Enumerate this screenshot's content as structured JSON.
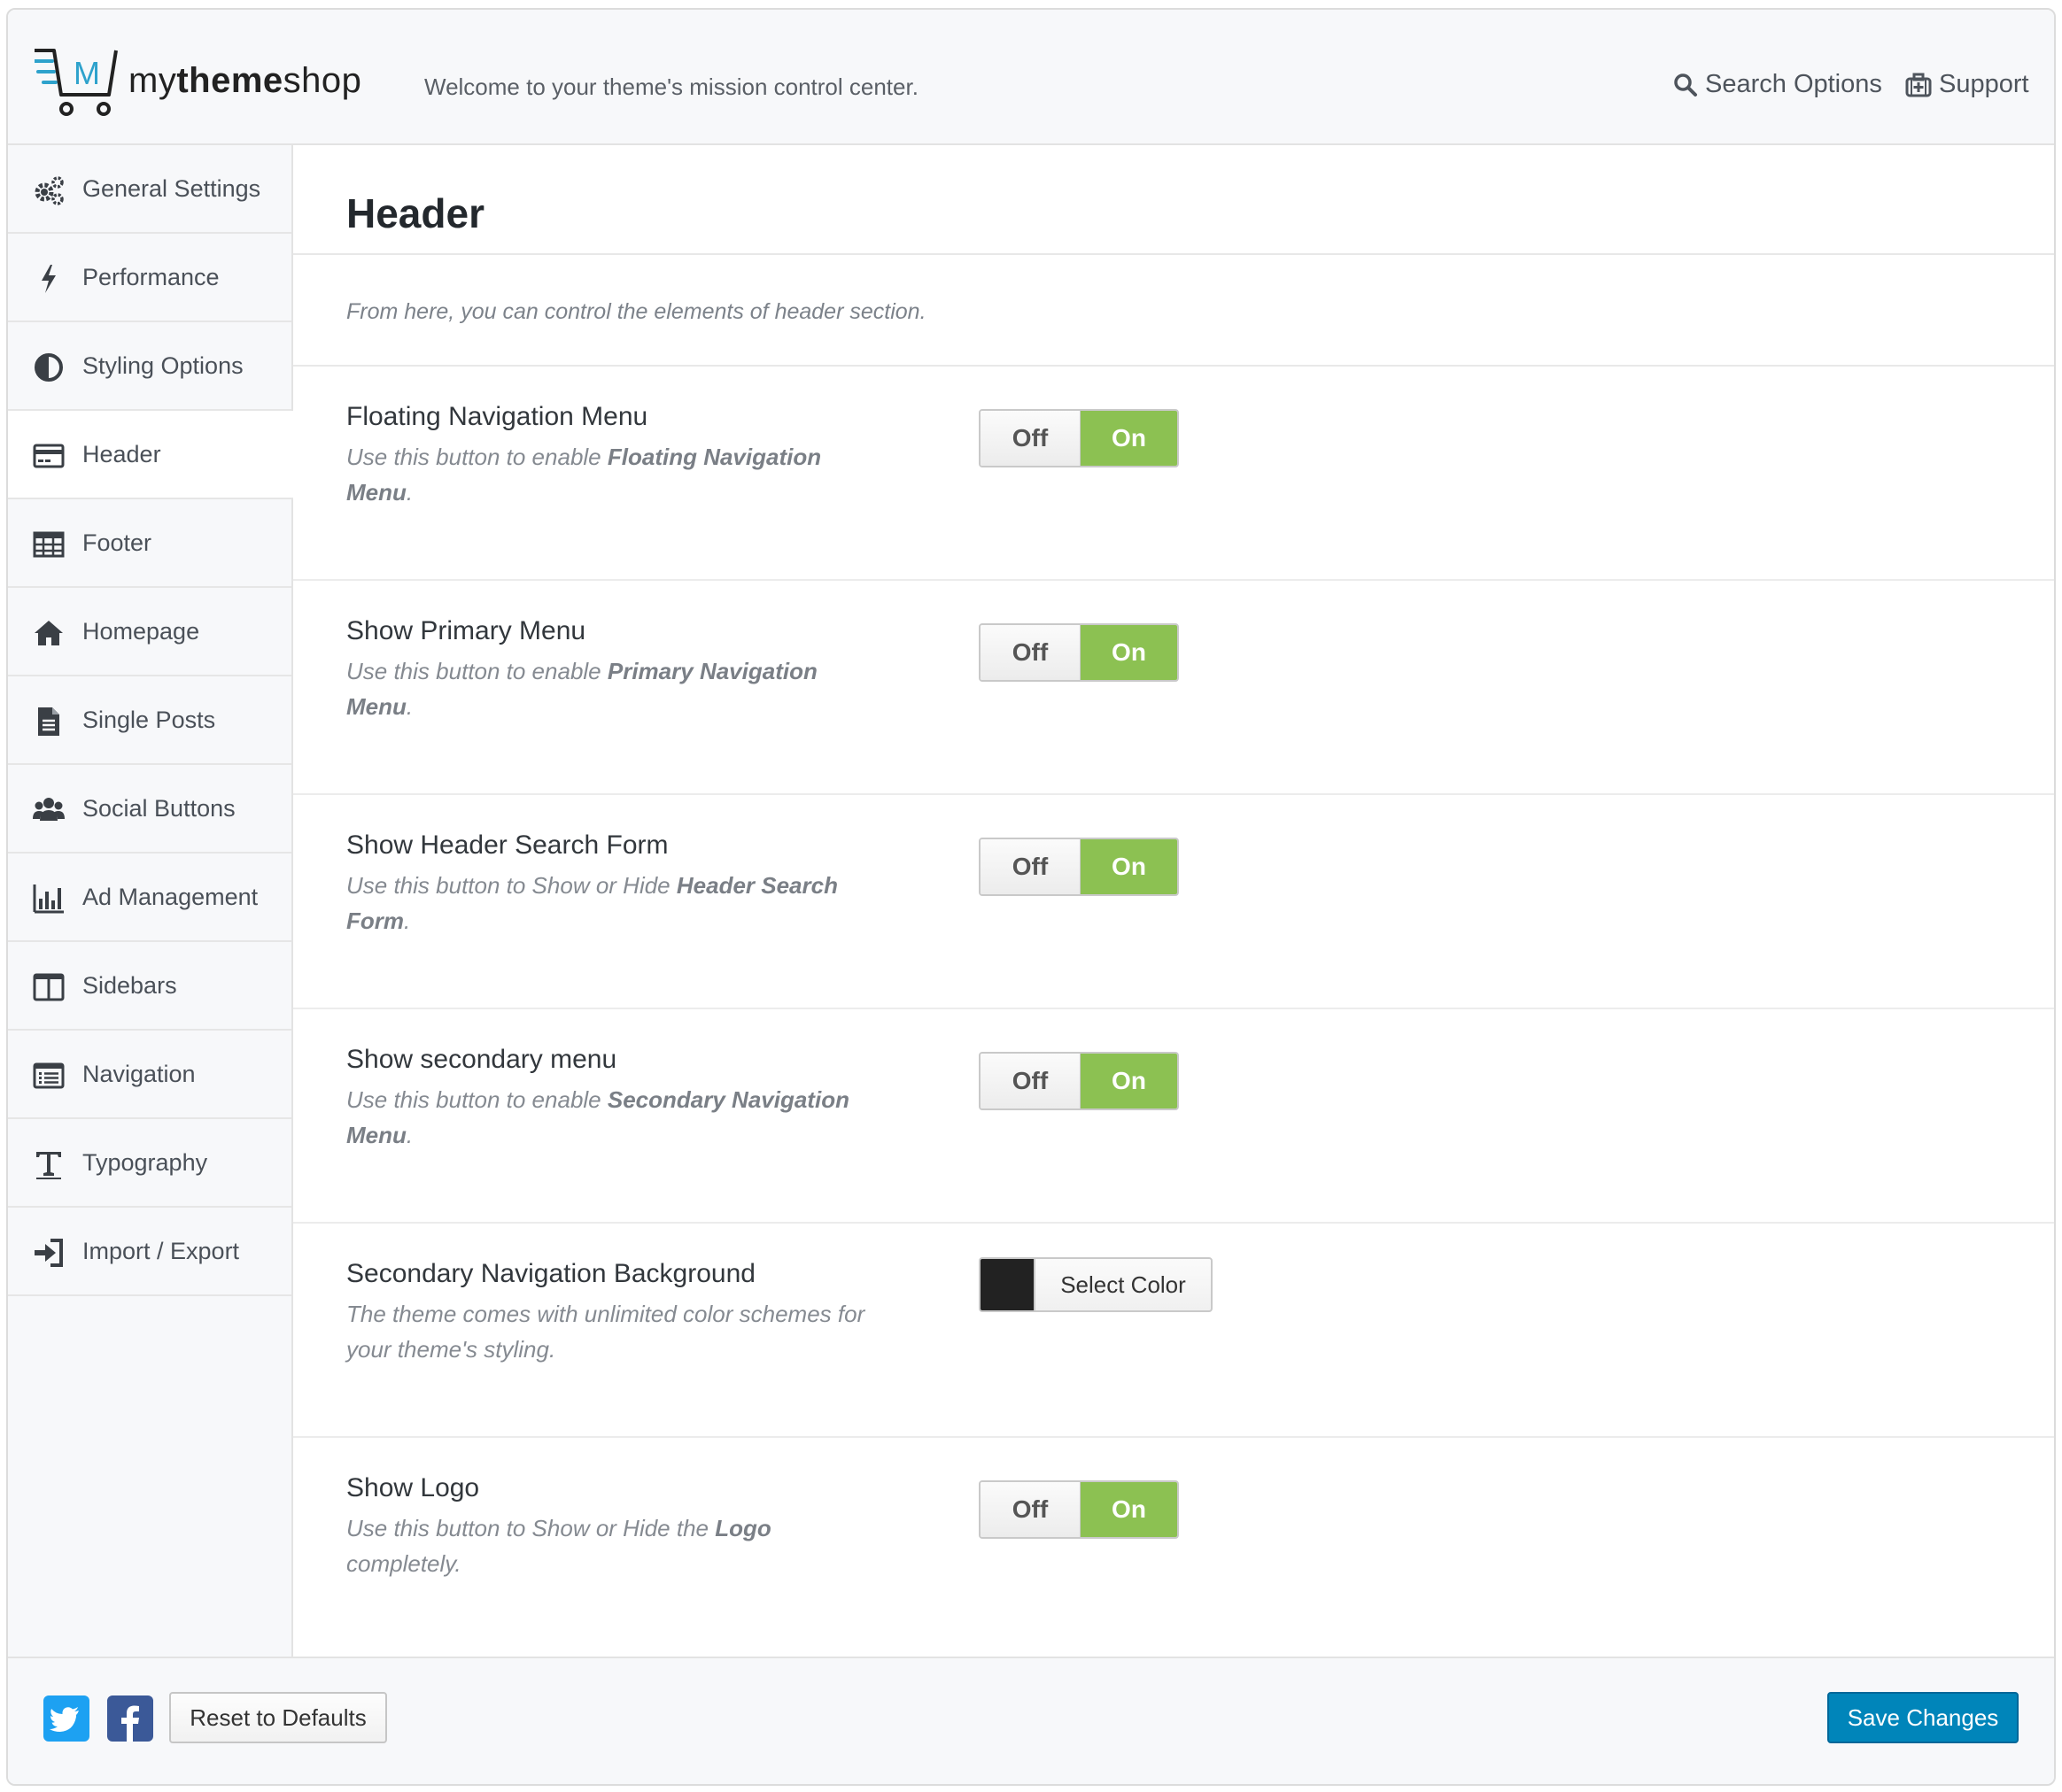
{
  "brand": {
    "name_prefix": "my",
    "name_bold": "theme",
    "name_suffix": "shop",
    "logo_letter": "M",
    "accent": "#2ea2cc"
  },
  "header": {
    "tagline": "Welcome to your theme's mission control center.",
    "search_label": "Search Options",
    "support_label": "Support"
  },
  "sidebar": {
    "active_index": 3,
    "items": [
      {
        "label": "General Settings",
        "icon": "gears-icon"
      },
      {
        "label": "Performance",
        "icon": "bolt-icon"
      },
      {
        "label": "Styling Options",
        "icon": "contrast-icon"
      },
      {
        "label": "Header",
        "icon": "credit-card-icon"
      },
      {
        "label": "Footer",
        "icon": "table-icon"
      },
      {
        "label": "Homepage",
        "icon": "home-icon"
      },
      {
        "label": "Single Posts",
        "icon": "file-text-icon"
      },
      {
        "label": "Social Buttons",
        "icon": "users-icon"
      },
      {
        "label": "Ad Management",
        "icon": "bar-chart-icon"
      },
      {
        "label": "Sidebars",
        "icon": "columns-icon"
      },
      {
        "label": "Navigation",
        "icon": "list-alt-icon"
      },
      {
        "label": "Typography",
        "icon": "text-height-icon"
      },
      {
        "label": "Import / Export",
        "icon": "sign-in-icon"
      }
    ]
  },
  "main": {
    "title": "Header",
    "intro": "From here, you can control the elements of header section.",
    "options": [
      {
        "title": "Floating Navigation Menu",
        "desc_pre": "Use this button to enable ",
        "desc_bold": "Floating Navigation Menu",
        "desc_post": ".",
        "control": "switch",
        "off_label": "Off",
        "on_label": "On",
        "value": "On"
      },
      {
        "title": "Show Primary Menu",
        "desc_pre": "Use this button to enable ",
        "desc_bold": "Primary Navigation Menu",
        "desc_post": ".",
        "control": "switch",
        "off_label": "Off",
        "on_label": "On",
        "value": "On"
      },
      {
        "title": "Show Header Search Form",
        "desc_pre": "Use this button to Show or Hide ",
        "desc_bold": "Header Search Form",
        "desc_post": ".",
        "control": "switch",
        "off_label": "Off",
        "on_label": "On",
        "value": "On"
      },
      {
        "title": "Show secondary menu",
        "desc_pre": "Use this button to enable ",
        "desc_bold": "Secondary Navigation Menu",
        "desc_post": ".",
        "control": "switch",
        "off_label": "Off",
        "on_label": "On",
        "value": "On"
      },
      {
        "title": "Secondary Navigation Background",
        "desc_pre": "The theme comes with unlimited color schemes for your theme's styling.",
        "desc_bold": "",
        "desc_post": "",
        "control": "color",
        "button_label": "Select Color",
        "color": "#222222"
      },
      {
        "title": "Show Logo",
        "desc_pre": "Use this button to Show or Hide the ",
        "desc_bold": "Logo",
        "desc_post": " completely.",
        "control": "switch",
        "off_label": "Off",
        "on_label": "On",
        "value": "On"
      }
    ]
  },
  "footer": {
    "twitter_icon": "twitter-icon",
    "facebook_icon": "facebook-icon",
    "reset_label": "Reset to Defaults",
    "save_label": "Save Changes"
  },
  "colors": {
    "switch_on": "#8cc152",
    "save_button": "#0085ba",
    "twitter": "#1da1f2",
    "facebook": "#3b5998"
  }
}
